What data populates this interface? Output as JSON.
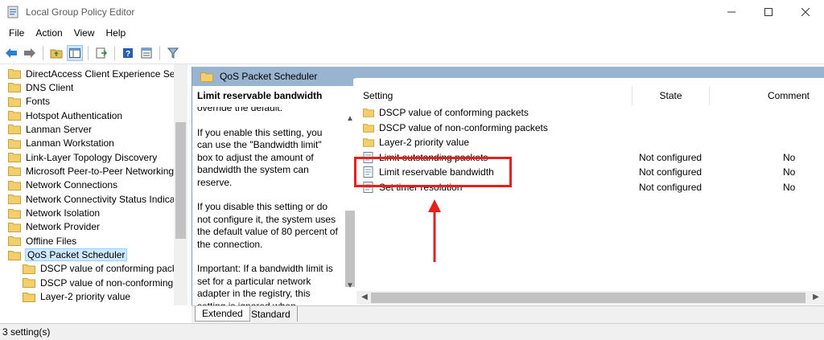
{
  "window": {
    "title": "Local Group Policy Editor",
    "controls": [
      "minimize",
      "maximize",
      "close"
    ]
  },
  "menu": [
    "File",
    "Action",
    "View",
    "Help"
  ],
  "toolbar": {
    "buttons": [
      "back-icon",
      "forward-icon",
      "up-folder-icon",
      "show-hide-tree-icon",
      "export-list-icon",
      "help-icon",
      "properties-icon",
      "filter-icon"
    ]
  },
  "tree": {
    "items": [
      {
        "label": "DirectAccess Client Experience Setti",
        "level": 0
      },
      {
        "label": "DNS Client",
        "level": 0
      },
      {
        "label": "Fonts",
        "level": 0
      },
      {
        "label": "Hotspot Authentication",
        "level": 0
      },
      {
        "label": "Lanman Server",
        "level": 0
      },
      {
        "label": "Lanman Workstation",
        "level": 0
      },
      {
        "label": "Link-Layer Topology Discovery",
        "level": 0
      },
      {
        "label": "Microsoft Peer-to-Peer Networking",
        "level": 0
      },
      {
        "label": "Network Connections",
        "level": 0
      },
      {
        "label": "Network Connectivity Status Indicat",
        "level": 0
      },
      {
        "label": "Network Isolation",
        "level": 0
      },
      {
        "label": "Network Provider",
        "level": 0
      },
      {
        "label": "Offline Files",
        "level": 0
      },
      {
        "label": "QoS Packet Scheduler",
        "level": 0,
        "selected": true
      },
      {
        "label": "DSCP value of conforming pack",
        "level": 1
      },
      {
        "label": "DSCP value of non-conforming",
        "level": 1
      },
      {
        "label": "Layer-2 priority value",
        "level": 1
      }
    ]
  },
  "right": {
    "header": "QoS Packet Scheduler",
    "description": {
      "title": "Limit reservable bandwidth",
      "paragraphs": [
        "override the default.",
        "If you enable this setting, you can use the \"Bandwidth limit\" box to adjust the amount of bandwidth the system can reserve.",
        "If you disable this setting or do not configure it, the system uses the default value of 80 percent of the connection.",
        "Important: If a bandwidth limit is set for a particular network adapter in the registry, this setting is ignored when configuring that network adapter."
      ]
    },
    "columns": {
      "setting": "Setting",
      "state": "State",
      "comment": "Comment"
    },
    "rows": [
      {
        "name": "DSCP value of conforming packets",
        "type": "folder",
        "state": "",
        "comment": ""
      },
      {
        "name": "DSCP value of non-conforming packets",
        "type": "folder",
        "state": "",
        "comment": ""
      },
      {
        "name": "Layer-2 priority value",
        "type": "folder",
        "state": "",
        "comment": ""
      },
      {
        "name": "Limit outstanding packets",
        "type": "setting",
        "state": "Not configured",
        "comment": "No"
      },
      {
        "name": "Limit reservable bandwidth",
        "type": "setting",
        "state": "Not configured",
        "comment": "No",
        "highlighted": true
      },
      {
        "name": "Set timer resolution",
        "type": "setting",
        "state": "Not configured",
        "comment": "No"
      }
    ],
    "tabs": [
      "Extended",
      "Standard"
    ]
  },
  "status": "3 setting(s)",
  "annotation": {
    "color": "#e8201c"
  }
}
